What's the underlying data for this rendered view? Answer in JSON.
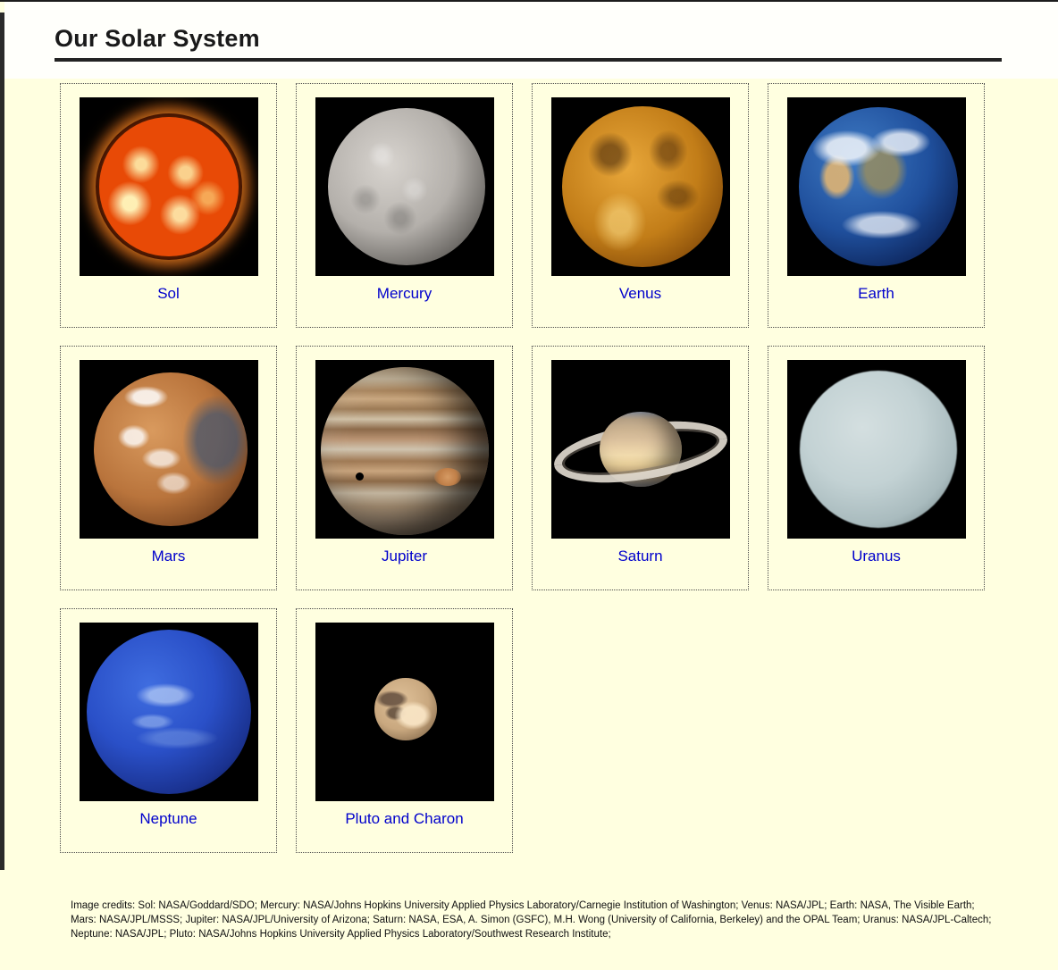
{
  "page": {
    "title": "Our Solar System",
    "background_color": "#FFFFE0",
    "link_color": "#0000CC",
    "title_color": "#1A1A1A"
  },
  "gallery": {
    "items": [
      {
        "label": "Sol",
        "icon": "sun-image",
        "frame_background": "#000000"
      },
      {
        "label": "Mercury",
        "icon": "mercury-image",
        "frame_background": "#000000"
      },
      {
        "label": "Venus",
        "icon": "venus-image",
        "frame_background": "#000000"
      },
      {
        "label": "Earth",
        "icon": "earth-image",
        "frame_background": "#000000"
      },
      {
        "label": "Mars",
        "icon": "mars-image",
        "frame_background": "#000000"
      },
      {
        "label": "Jupiter",
        "icon": "jupiter-image",
        "frame_background": "#000000"
      },
      {
        "label": "Saturn",
        "icon": "saturn-image",
        "frame_background": "#000000"
      },
      {
        "label": "Uranus",
        "icon": "uranus-image",
        "frame_background": "#000000"
      },
      {
        "label": "Neptune",
        "icon": "neptune-image",
        "frame_background": "#000000"
      },
      {
        "label": "Pluto and Charon",
        "icon": "pluto-image",
        "frame_background": "#000000"
      }
    ]
  },
  "credits": {
    "text": "Image credits: Sol: NASA/Goddard/SDO; Mercury: NASA/Johns Hopkins University Applied Physics Laboratory/Carnegie Institution of Washington; Venus: NASA/JPL; Earth: NASA, The Visible Earth; Mars: NASA/JPL/MSSS; Jupiter: NASA/JPL/University of Arizona; Saturn: NASA, ESA, A. Simon (GSFC), M.H. Wong (University of California, Berkeley) and the OPAL Team; Uranus: NASA/JPL-Caltech; Neptune: NASA/JPL; Pluto: NASA/Johns Hopkins University Applied Physics Laboratory/Southwest Research Institute;"
  }
}
